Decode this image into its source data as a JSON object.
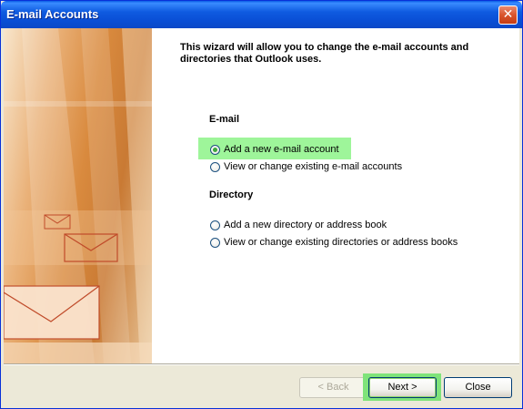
{
  "window": {
    "title": "E-mail Accounts",
    "close_glyph": "✕"
  },
  "intro": {
    "text": "This wizard will allow you to change the e-mail accounts and directories that Outlook uses."
  },
  "email_section": {
    "label": "E-mail",
    "options": [
      {
        "label": "Add a new e-mail account",
        "checked": true
      },
      {
        "label": "View or change existing e-mail accounts",
        "checked": false
      }
    ]
  },
  "directory_section": {
    "label": "Directory",
    "options": [
      {
        "label": "Add a new directory or address book",
        "checked": false
      },
      {
        "label": "View or change existing directories or address books",
        "checked": false
      }
    ]
  },
  "buttons": {
    "back": "< Back",
    "next": "Next >",
    "close": "Close"
  },
  "colors": {
    "titlebar": "#0a4fd6",
    "highlight": "#9ef59a",
    "radio_dot": "#3da83a"
  }
}
